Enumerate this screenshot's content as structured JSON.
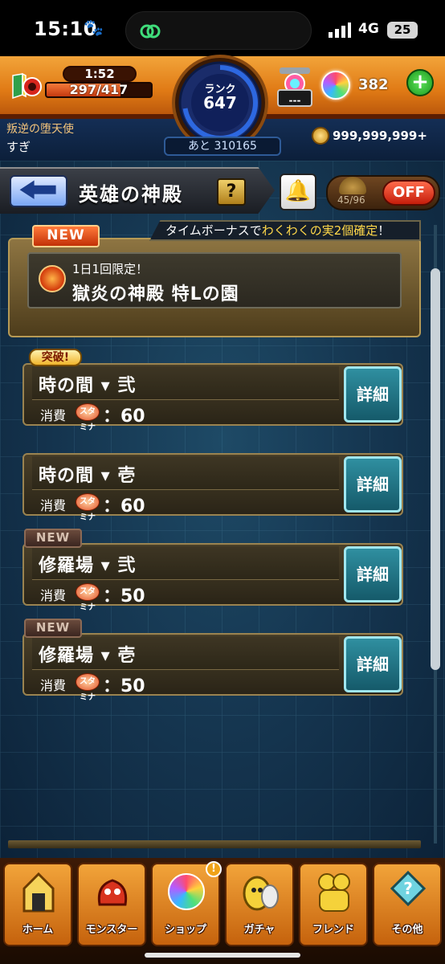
{
  "status_bar": {
    "time": "15:10",
    "network": "4G",
    "battery": "25"
  },
  "header": {
    "timer": "1:52",
    "stamina": "297/417",
    "stamina_fraction": 0.71,
    "rank_label": "ランク",
    "rank": "647",
    "rank_remaining": "あと 310165",
    "gem_label": "---",
    "orb_count": "382",
    "player_title": "叛逆の堕天使",
    "player_name": "すぎ",
    "coins": "999,999,999+"
  },
  "page": {
    "title": "英雄の神殿",
    "help": "?",
    "auto_count": "45/96",
    "auto_toggle": "OFF",
    "bonus_prefix": "タイムボーナスで",
    "bonus_highlight": "わくわくの実2個確定",
    "bonus_suffix": "！"
  },
  "event": {
    "badge": "NEW",
    "limit": "1日1回限定！",
    "name": "獄炎の神殿 特Lの園"
  },
  "quests": [
    {
      "badge": "突破!",
      "name": "時の間 ▾ 弐",
      "cost_label": "消費",
      "stamina_icon": "スタミナ",
      "cost": "：60",
      "detail": "詳細"
    },
    {
      "badge": "",
      "name": "時の間 ▾ 壱",
      "cost_label": "消費",
      "stamina_icon": "スタミナ",
      "cost": "：60",
      "detail": "詳細"
    },
    {
      "badge": "NEW",
      "name": "修羅場 ▾ 弐",
      "cost_label": "消費",
      "stamina_icon": "スタミナ",
      "cost": "：50",
      "detail": "詳細"
    },
    {
      "badge": "NEW",
      "name": "修羅場 ▾ 壱",
      "cost_label": "消費",
      "stamina_icon": "スタミナ",
      "cost": "：50",
      "detail": "詳細"
    }
  ],
  "nav": [
    {
      "label": "ホーム",
      "icon": "home-icon"
    },
    {
      "label": "モンスター",
      "icon": "monster-icon"
    },
    {
      "label": "ショップ",
      "icon": "orb-icon",
      "badge": "!"
    },
    {
      "label": "ガチャ",
      "icon": "gacha-icon"
    },
    {
      "label": "フレンド",
      "icon": "friend-icon"
    },
    {
      "label": "その他",
      "icon": "other-icon"
    }
  ],
  "colors": {
    "header_gold": "#e07a15",
    "main_bg": "#14334d",
    "detail_button": "#2f8fa0",
    "off_button": "#c41d0b",
    "highlight_text": "#ffd84a"
  }
}
